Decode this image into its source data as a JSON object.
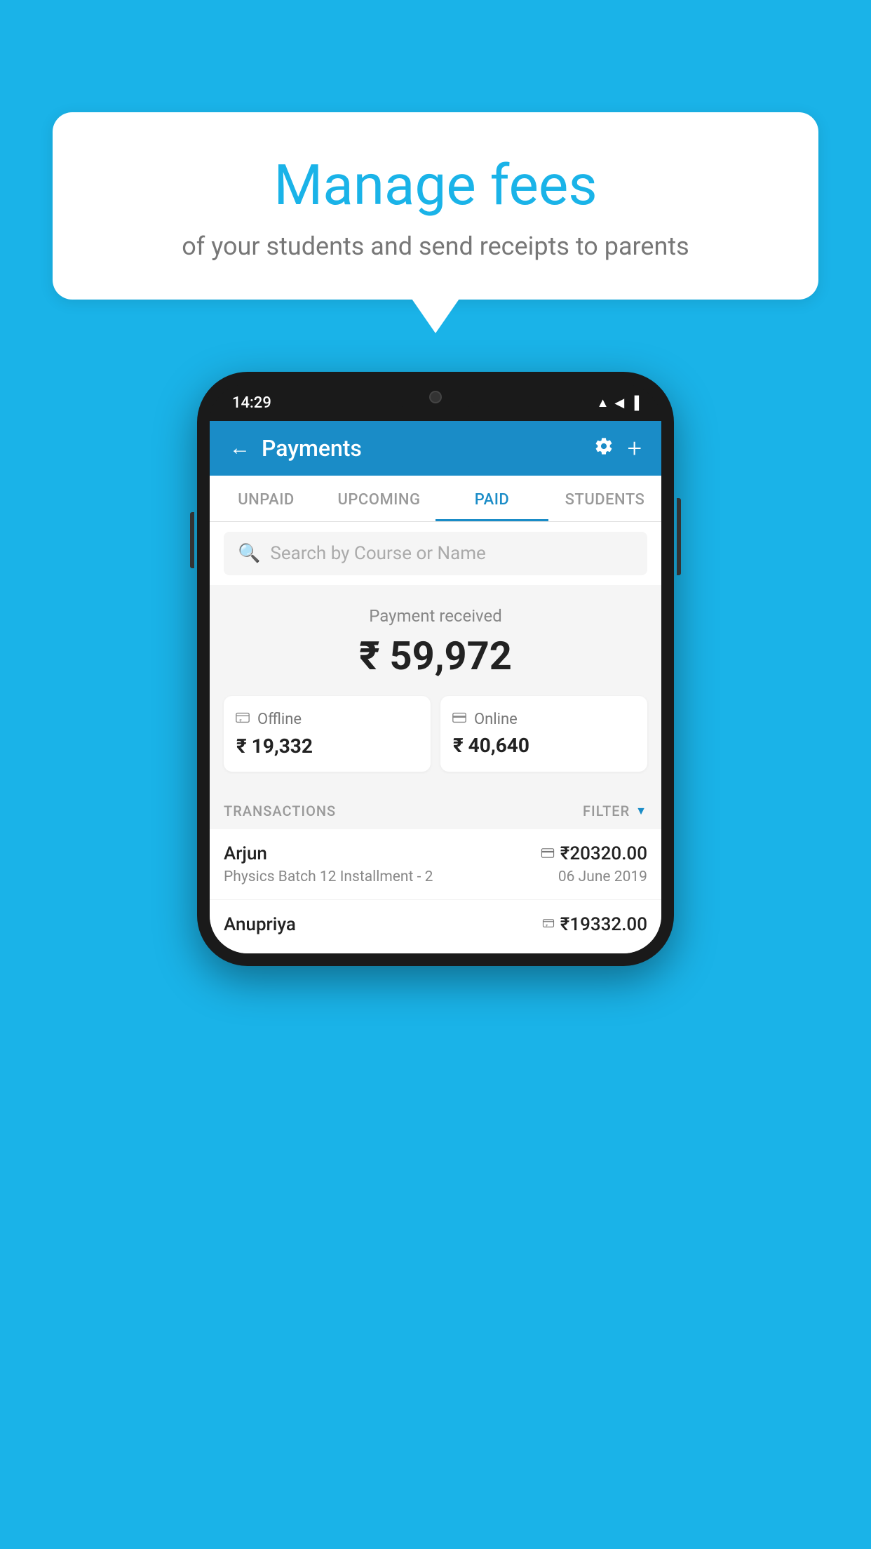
{
  "background_color": "#1ab3e8",
  "speech_bubble": {
    "title": "Manage fees",
    "subtitle": "of your students and send receipts to parents"
  },
  "phone": {
    "status_bar": {
      "time": "14:29",
      "icons": "▲◀▐"
    },
    "app_bar": {
      "title": "Payments",
      "back_icon": "←",
      "settings_icon": "⚙",
      "add_icon": "+"
    },
    "tabs": [
      {
        "label": "UNPAID",
        "active": false
      },
      {
        "label": "UPCOMING",
        "active": false
      },
      {
        "label": "PAID",
        "active": true
      },
      {
        "label": "STUDENTS",
        "active": false
      }
    ],
    "search": {
      "placeholder": "Search by Course or Name"
    },
    "payment_summary": {
      "label": "Payment received",
      "amount": "₹ 59,972",
      "offline": {
        "label": "Offline",
        "amount": "₹ 19,332",
        "icon": "💳"
      },
      "online": {
        "label": "Online",
        "amount": "₹ 40,640",
        "icon": "💳"
      }
    },
    "transactions_section": {
      "label": "TRANSACTIONS",
      "filter_label": "FILTER"
    },
    "transactions": [
      {
        "name": "Arjun",
        "amount": "₹20320.00",
        "payment_type": "card",
        "detail": "Physics Batch 12 Installment - 2",
        "date": "06 June 2019"
      },
      {
        "name": "Anupriya",
        "amount": "₹19332.00",
        "payment_type": "cash",
        "detail": "",
        "date": ""
      }
    ]
  }
}
